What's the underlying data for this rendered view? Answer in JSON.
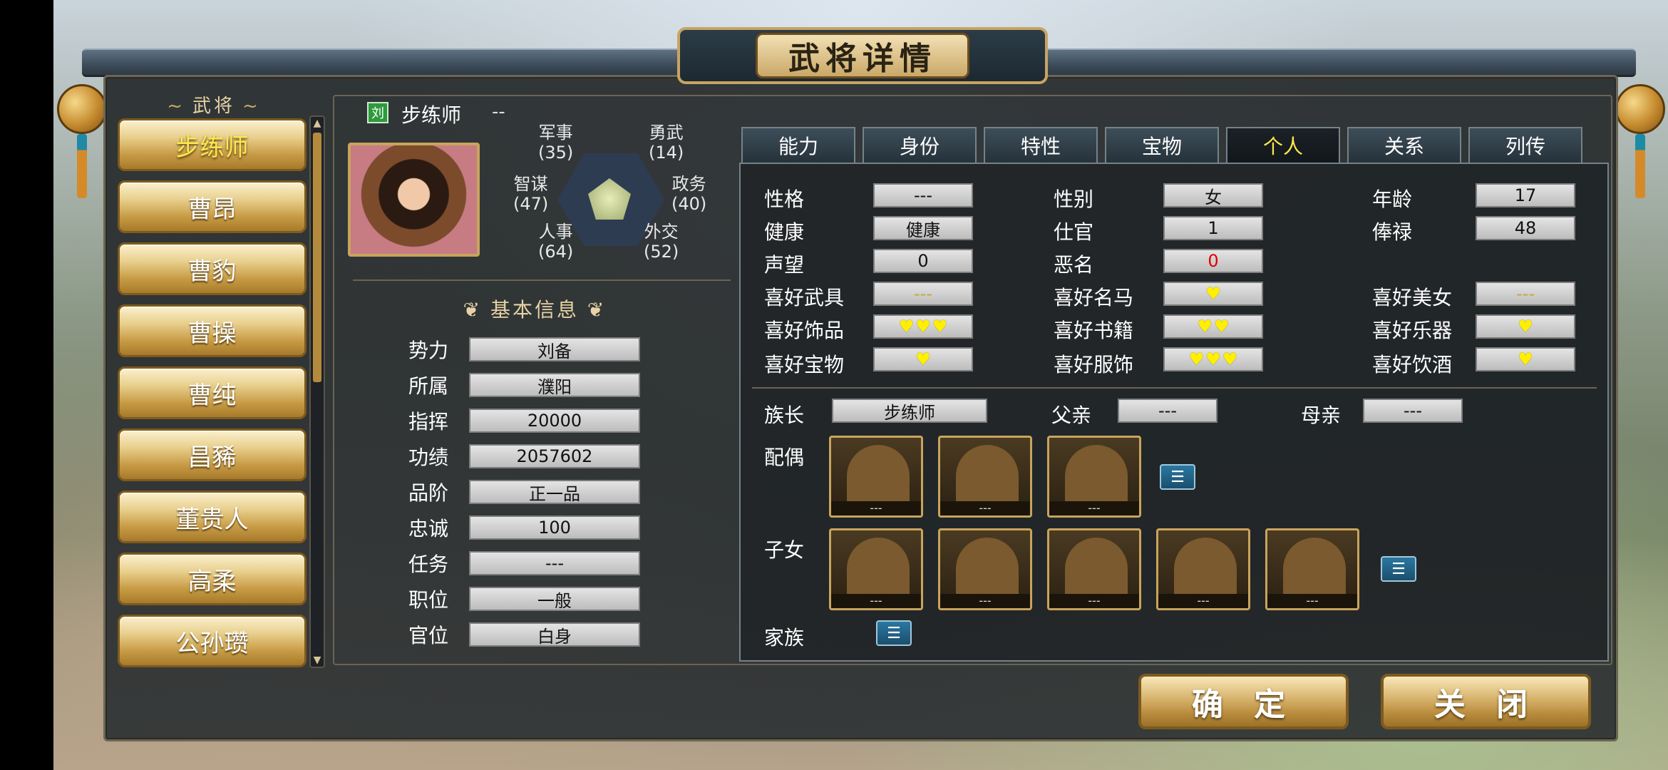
{
  "title": "武将详情",
  "hero_list": {
    "title": "武将",
    "items": [
      "步练师",
      "曹昂",
      "曹豹",
      "曹操",
      "曹纯",
      "昌豨",
      "董贵人",
      "高柔",
      "公孙瓒"
    ],
    "selected_index": 0
  },
  "hero": {
    "faction_badge": "刘",
    "name": "步练师",
    "suffix": "--",
    "stats": {
      "military": {
        "label": "军事",
        "value": "(35)"
      },
      "valor": {
        "label": "勇武",
        "value": "(14)"
      },
      "strategy": {
        "label": "智谋",
        "value": "(47)"
      },
      "politics": {
        "label": "政务",
        "value": "(40)"
      },
      "personnel": {
        "label": "人事",
        "value": "(64)"
      },
      "diplomacy": {
        "label": "外交",
        "value": "(52)"
      }
    }
  },
  "basic_info": {
    "title": "基本信息",
    "rows": [
      {
        "label": "势力",
        "value": "刘备"
      },
      {
        "label": "所属",
        "value": "濮阳"
      },
      {
        "label": "指挥",
        "value": "20000"
      },
      {
        "label": "功绩",
        "value": "2057602"
      },
      {
        "label": "品阶",
        "value": "正一品"
      },
      {
        "label": "忠诚",
        "value": "100"
      },
      {
        "label": "任务",
        "value": "---"
      },
      {
        "label": "职位",
        "value": "一般"
      },
      {
        "label": "官位",
        "value": "白身"
      }
    ]
  },
  "tabs": [
    "能力",
    "身份",
    "特性",
    "宝物",
    "个人",
    "关系",
    "列传"
  ],
  "active_tab": 4,
  "personal": {
    "personality": {
      "label": "性格",
      "value": "---"
    },
    "gender": {
      "label": "性别",
      "value": "女"
    },
    "age": {
      "label": "年龄",
      "value": "17"
    },
    "health": {
      "label": "健康",
      "value": "健康"
    },
    "official": {
      "label": "仕官",
      "value": "1"
    },
    "salary": {
      "label": "俸禄",
      "value": "48"
    },
    "fame": {
      "label": "声望",
      "value": "0"
    },
    "infamy": {
      "label": "恶名",
      "value": "0"
    },
    "fav_weapon": {
      "label": "喜好武具",
      "value": "---",
      "hearts": 0
    },
    "fav_horse": {
      "label": "喜好名马",
      "hearts": 1
    },
    "fav_beauty": {
      "label": "喜好美女",
      "value": "---",
      "hearts": 0
    },
    "fav_jewelry": {
      "label": "喜好饰品",
      "hearts": 3
    },
    "fav_books": {
      "label": "喜好书籍",
      "hearts": 2
    },
    "fav_music": {
      "label": "喜好乐器",
      "hearts": 1
    },
    "fav_treasure": {
      "label": "喜好宝物",
      "hearts": 1
    },
    "fav_clothing": {
      "label": "喜好服饰",
      "hearts": 3
    },
    "fav_wine": {
      "label": "喜好饮酒",
      "hearts": 1
    }
  },
  "family": {
    "clan_head": {
      "label": "族长",
      "value": "步练师"
    },
    "father": {
      "label": "父亲",
      "value": "---"
    },
    "mother": {
      "label": "母亲",
      "value": "---"
    },
    "spouse_label": "配偶",
    "spouses": [
      "---",
      "---",
      "---"
    ],
    "children_label": "子女",
    "children": [
      "---",
      "---",
      "---",
      "---",
      "---"
    ],
    "clan_label": "家族"
  },
  "buttons": {
    "confirm": "确 定",
    "close": "关 闭"
  },
  "colors": {
    "accent_gold": "#c9a45c",
    "selected_text": "#ffe84a",
    "heart": "#ffef00",
    "infamy_red": "#e00000"
  }
}
